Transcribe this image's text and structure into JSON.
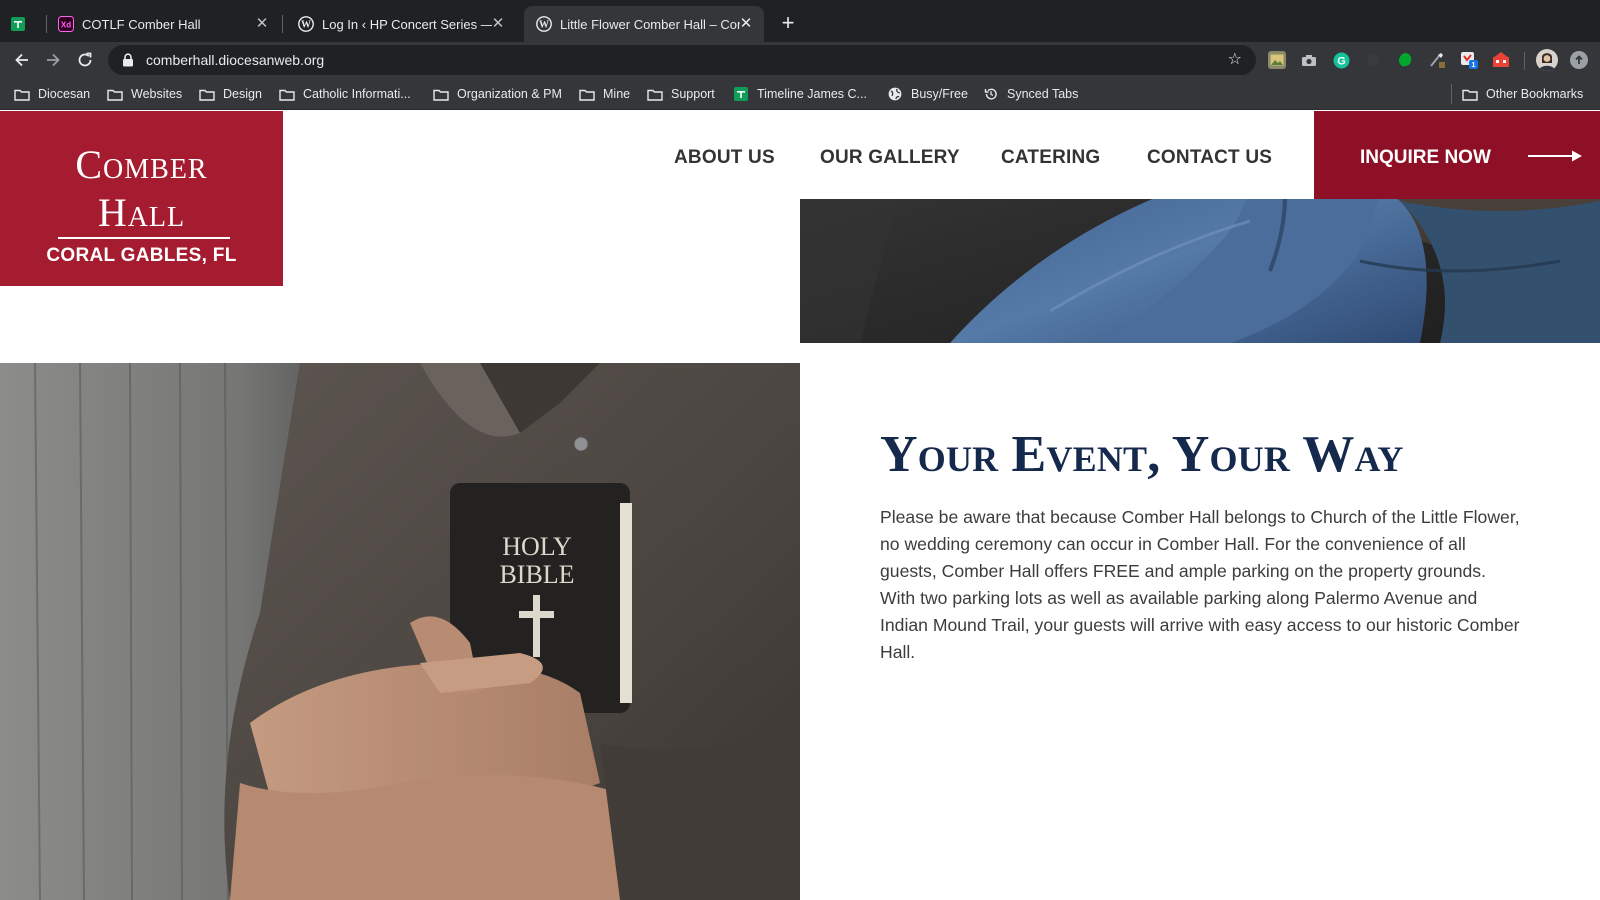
{
  "browser": {
    "tabs": [
      {
        "title": "",
        "favicon": "google-sheets-icon",
        "active": false
      },
      {
        "title": "COTLF Comber Hall",
        "favicon": "adobe-xd-icon",
        "active": false
      },
      {
        "title": "Log In ‹ HP Concert Series — W",
        "favicon": "wordpress-icon",
        "active": false
      },
      {
        "title": "Little Flower Comber Hall – Cor",
        "favicon": "wordpress-icon",
        "active": true
      }
    ],
    "close_glyph": "✕",
    "new_tab_glyph": "+",
    "url": "comberhall.diocesanweb.org",
    "bookmarks": [
      {
        "label": "Diocesan",
        "icon": "folder-icon"
      },
      {
        "label": "Websites",
        "icon": "folder-icon"
      },
      {
        "label": "Design",
        "icon": "folder-icon"
      },
      {
        "label": "Catholic Informati...",
        "icon": "folder-icon"
      },
      {
        "label": "Organization & PM",
        "icon": "folder-icon"
      },
      {
        "label": "Mine",
        "icon": "folder-icon"
      },
      {
        "label": "Support",
        "icon": "folder-icon"
      },
      {
        "label": "Timeline James C...",
        "icon": "google-sheets-icon"
      },
      {
        "label": "Busy/Free",
        "icon": "globe-icon"
      },
      {
        "label": "Synced Tabs",
        "icon": "history-icon"
      }
    ],
    "other_bookmarks": "Other Bookmarks"
  },
  "site": {
    "logo": {
      "line1": "Comber",
      "line2": "Hall",
      "line3": "CORAL GABLES, FL"
    },
    "nav": [
      "ABOUT US",
      "OUR GALLERY",
      "CATERING",
      "CONTACT US"
    ],
    "cta_label": "INQUIRE NOW",
    "bible": {
      "line1": "HOLY",
      "line2": "BIBLE"
    },
    "headline": "Your Event, Your Way",
    "body": "Please be aware that because Comber Hall belongs to Church of the Little Flower, no wedding ceremony can occur in Comber Hall. For the convenience of all guests, Comber Hall offers FREE and ample parking on the property grounds. With two parking lots as well as available parking along Palermo Avenue and Indian Mound Trail, your guests will arrive with easy access to our historic Comber Hall."
  },
  "colors": {
    "chrome_dark": "#202124",
    "chrome_toolbar": "#35363a",
    "logo_red": "#a51c30",
    "cta_red": "#8e1027",
    "headline_navy": "#14294b"
  }
}
